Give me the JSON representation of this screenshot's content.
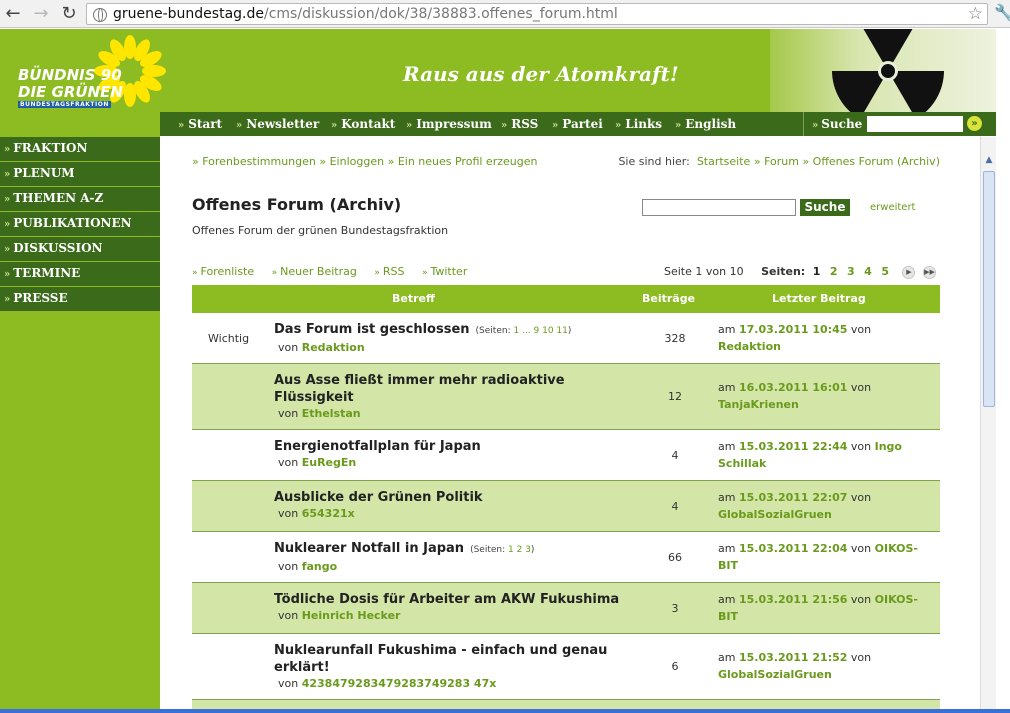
{
  "browser": {
    "url_host": "gruene-bundestag.de",
    "url_path": "/cms/diskussion/dok/38/38883.offenes_forum.html"
  },
  "header": {
    "logo_line1": "BÜNDNIS 90",
    "logo_line2": "DIE GRÜNEN",
    "logo_line3": "BUNDESTAGSFRAKTION",
    "slogan": "Raus aus der Atomkraft!"
  },
  "topnav": {
    "items": [
      "Start",
      "Newsletter",
      "Kontakt",
      "Impressum",
      "RSS",
      "Partei",
      "Links",
      "English"
    ],
    "search_label": "Suche"
  },
  "sidebar": {
    "items": [
      "FRAKTION",
      "PLENUM",
      "THEMEN A-Z",
      "PUBLIKATIONEN",
      "DISKUSSION",
      "TERMINE",
      "PRESSE"
    ]
  },
  "breadcrumbs": {
    "left": [
      "Forenbestimmungen",
      "Einloggen",
      "Ein neues Profil erzeugen"
    ],
    "you_are_here": "Sie sind hier:",
    "trail": [
      "Startseite",
      "Forum",
      "Offenes Forum (Archiv)"
    ]
  },
  "page": {
    "title": "Offenes Forum (Archiv)",
    "subtitle": "Offenes Forum der grünen Bundestagsfraktion",
    "search_button": "Suche",
    "advanced": "erweitert"
  },
  "actions": [
    "Forenliste",
    "Neuer Beitrag",
    "RSS",
    "Twitter"
  ],
  "pager": {
    "info": "Seite 1 von 10",
    "pages_label": "Seiten:",
    "pages": [
      "1",
      "2",
      "3",
      "4",
      "5"
    ],
    "current": "1"
  },
  "table": {
    "headers": {
      "topic": "Betreff",
      "count": "Beiträge",
      "last": "Letzter Beitrag"
    },
    "rows": [
      {
        "tag": "Wichtig",
        "title": "Das Forum ist geschlossen",
        "pages_prefix": "(Seiten:",
        "pages_links": "1 ... 9 10 11",
        "pages_suffix": ")",
        "by_prefix": "von",
        "author": "Redaktion",
        "count": "328",
        "am": "am",
        "date": "17.03.2011 10:45",
        "von": "von",
        "last_author": "Redaktion"
      },
      {
        "tag": "",
        "title": "Aus Asse fließt immer mehr radioaktive Flüssigkeit",
        "pages_prefix": "",
        "pages_links": "",
        "pages_suffix": "",
        "by_prefix": "von",
        "author": "Ethelstan",
        "count": "12",
        "am": "am",
        "date": "16.03.2011 16:01",
        "von": "von",
        "last_author": "TanjaKrienen"
      },
      {
        "tag": "",
        "title": "Energienotfallplan für Japan",
        "pages_prefix": "",
        "pages_links": "",
        "pages_suffix": "",
        "by_prefix": "von",
        "author": "EuRegEn",
        "count": "4",
        "am": "am",
        "date": "15.03.2011 22:44",
        "von": "von",
        "last_author": "Ingo Schillak"
      },
      {
        "tag": "",
        "title": "Ausblicke der Grünen Politik",
        "pages_prefix": "",
        "pages_links": "",
        "pages_suffix": "",
        "by_prefix": "von",
        "author": "654321x",
        "count": "4",
        "am": "am",
        "date": "15.03.2011 22:07",
        "von": "von",
        "last_author": "GlobalSozialGruen"
      },
      {
        "tag": "",
        "title": "Nuklearer Notfall in Japan",
        "pages_prefix": "(Seiten:",
        "pages_links": "1 2 3",
        "pages_suffix": ")",
        "by_prefix": "von",
        "author": "fango",
        "count": "66",
        "am": "am",
        "date": "15.03.2011 22:04",
        "von": "von",
        "last_author": "OIKOS-BIT"
      },
      {
        "tag": "",
        "title": "Tödliche Dosis für Arbeiter am AKW Fukushima",
        "pages_prefix": "",
        "pages_links": "",
        "pages_suffix": "",
        "by_prefix": "von",
        "author": "Heinrich Hecker",
        "count": "3",
        "am": "am",
        "date": "15.03.2011 21:56",
        "von": "von",
        "last_author": "OIKOS-BIT"
      },
      {
        "tag": "",
        "title": "Nuklearunfall Fukushima - einfach und genau erklärt!",
        "pages_prefix": "",
        "pages_links": "",
        "pages_suffix": "",
        "by_prefix": "von",
        "author": "4238479283479283749283 47x",
        "count": "6",
        "am": "am",
        "date": "15.03.2011 21:52",
        "von": "von",
        "last_author": "GlobalSozialGruen"
      }
    ]
  },
  "colors": {
    "brand_green": "#8cbb22",
    "dark_green": "#3b6a1b",
    "row_alt": "#d3e6a8",
    "link_green": "#6a9a1c"
  }
}
